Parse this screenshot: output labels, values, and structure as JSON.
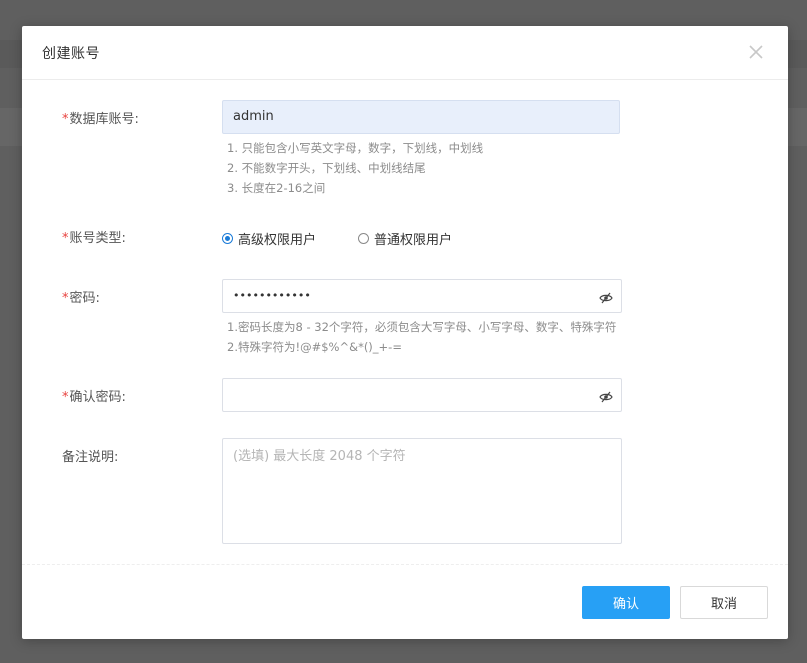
{
  "dialog": {
    "title": "创建账号",
    "close_icon": "close-icon"
  },
  "form": {
    "db_account": {
      "required": "*",
      "label": "数据库账号:",
      "value": "admin",
      "hints": [
        "1. 只能包含小写英文字母，数字，下划线，中划线",
        "2. 不能数字开头，下划线、中划线结尾",
        "3. 长度在2-16之间"
      ]
    },
    "account_type": {
      "required": "*",
      "label": "账号类型:",
      "options": [
        {
          "label": "高级权限用户",
          "checked": true
        },
        {
          "label": "普通权限用户",
          "checked": false
        }
      ]
    },
    "password": {
      "required": "*",
      "label": "密码:",
      "value": "••••••••••••",
      "icon": "eye-icon",
      "hints": [
        "1.密码长度为8 - 32个字符，必须包含大写字母、小写字母、数字、特殊字符",
        "2.特殊字符为!@#$%^&*()_+-="
      ]
    },
    "confirm_password": {
      "required": "*",
      "label": "确认密码:",
      "value": "",
      "icon": "eye-icon"
    },
    "remark": {
      "label": "备注说明:",
      "placeholder": "(选填) 最大长度 2048 个字符"
    }
  },
  "footer": {
    "confirm_label": "确认",
    "cancel_label": "取消"
  },
  "colors": {
    "primary": "#27a0f5",
    "required": "#e8423f",
    "radio_checked": "#1a7bd8",
    "filled_input": "#e8effb"
  }
}
